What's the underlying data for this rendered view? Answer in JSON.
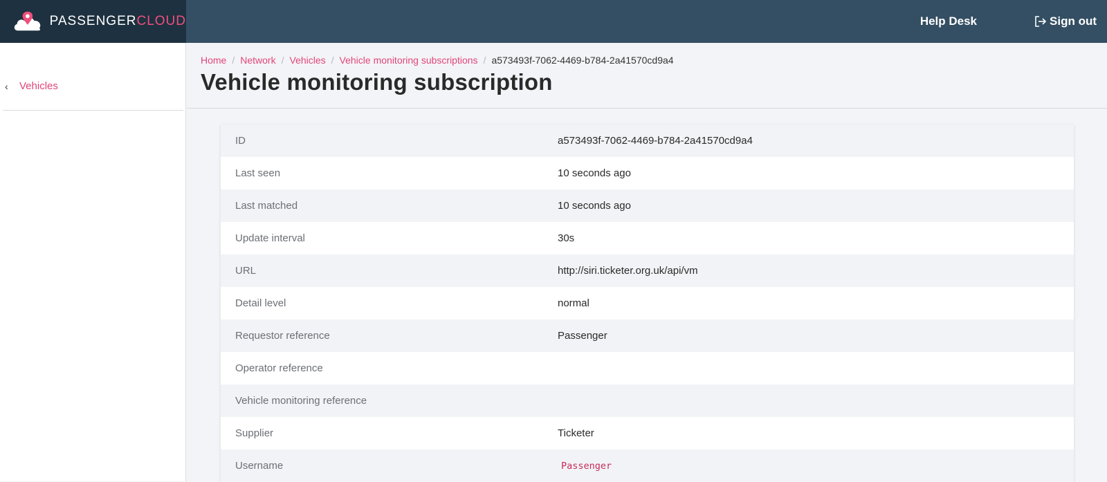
{
  "brand": {
    "name_part1": "PASSENGER",
    "name_part2": "CLOUD",
    "logo_icon": "cloud-pin-icon",
    "accent_color": "#ee4f7c"
  },
  "topnav": {
    "help_label": "Help Desk",
    "signout_label": "Sign out",
    "signout_icon": "sign-out-icon"
  },
  "sidebar": {
    "back_label": "Vehicles",
    "back_icon": "chevron-left-icon"
  },
  "breadcrumb": {
    "items": [
      "Home",
      "Network",
      "Vehicles",
      "Vehicle monitoring subscriptions"
    ],
    "current": "a573493f-7062-4469-b784-2a41570cd9a4"
  },
  "page": {
    "title": "Vehicle monitoring subscription"
  },
  "details": [
    {
      "label": "ID",
      "value": "a573493f-7062-4469-b784-2a41570cd9a4"
    },
    {
      "label": "Last seen",
      "value": "10 seconds ago"
    },
    {
      "label": "Last matched",
      "value": "10 seconds ago"
    },
    {
      "label": "Update interval",
      "value": "30s"
    },
    {
      "label": "URL",
      "value": "http://siri.ticketer.org.uk/api/vm"
    },
    {
      "label": "Detail level",
      "value": "normal"
    },
    {
      "label": "Requestor reference",
      "value": "Passenger"
    },
    {
      "label": "Operator reference",
      "value": ""
    },
    {
      "label": "Vehicle monitoring reference",
      "value": ""
    },
    {
      "label": "Supplier",
      "value": "Ticketer"
    },
    {
      "label": "Username",
      "value": "Passenger"
    }
  ],
  "colors": {
    "topbar": "#344f63",
    "brand_bg": "#1e3140",
    "link": "#e0457a",
    "code": "#c72c59"
  }
}
